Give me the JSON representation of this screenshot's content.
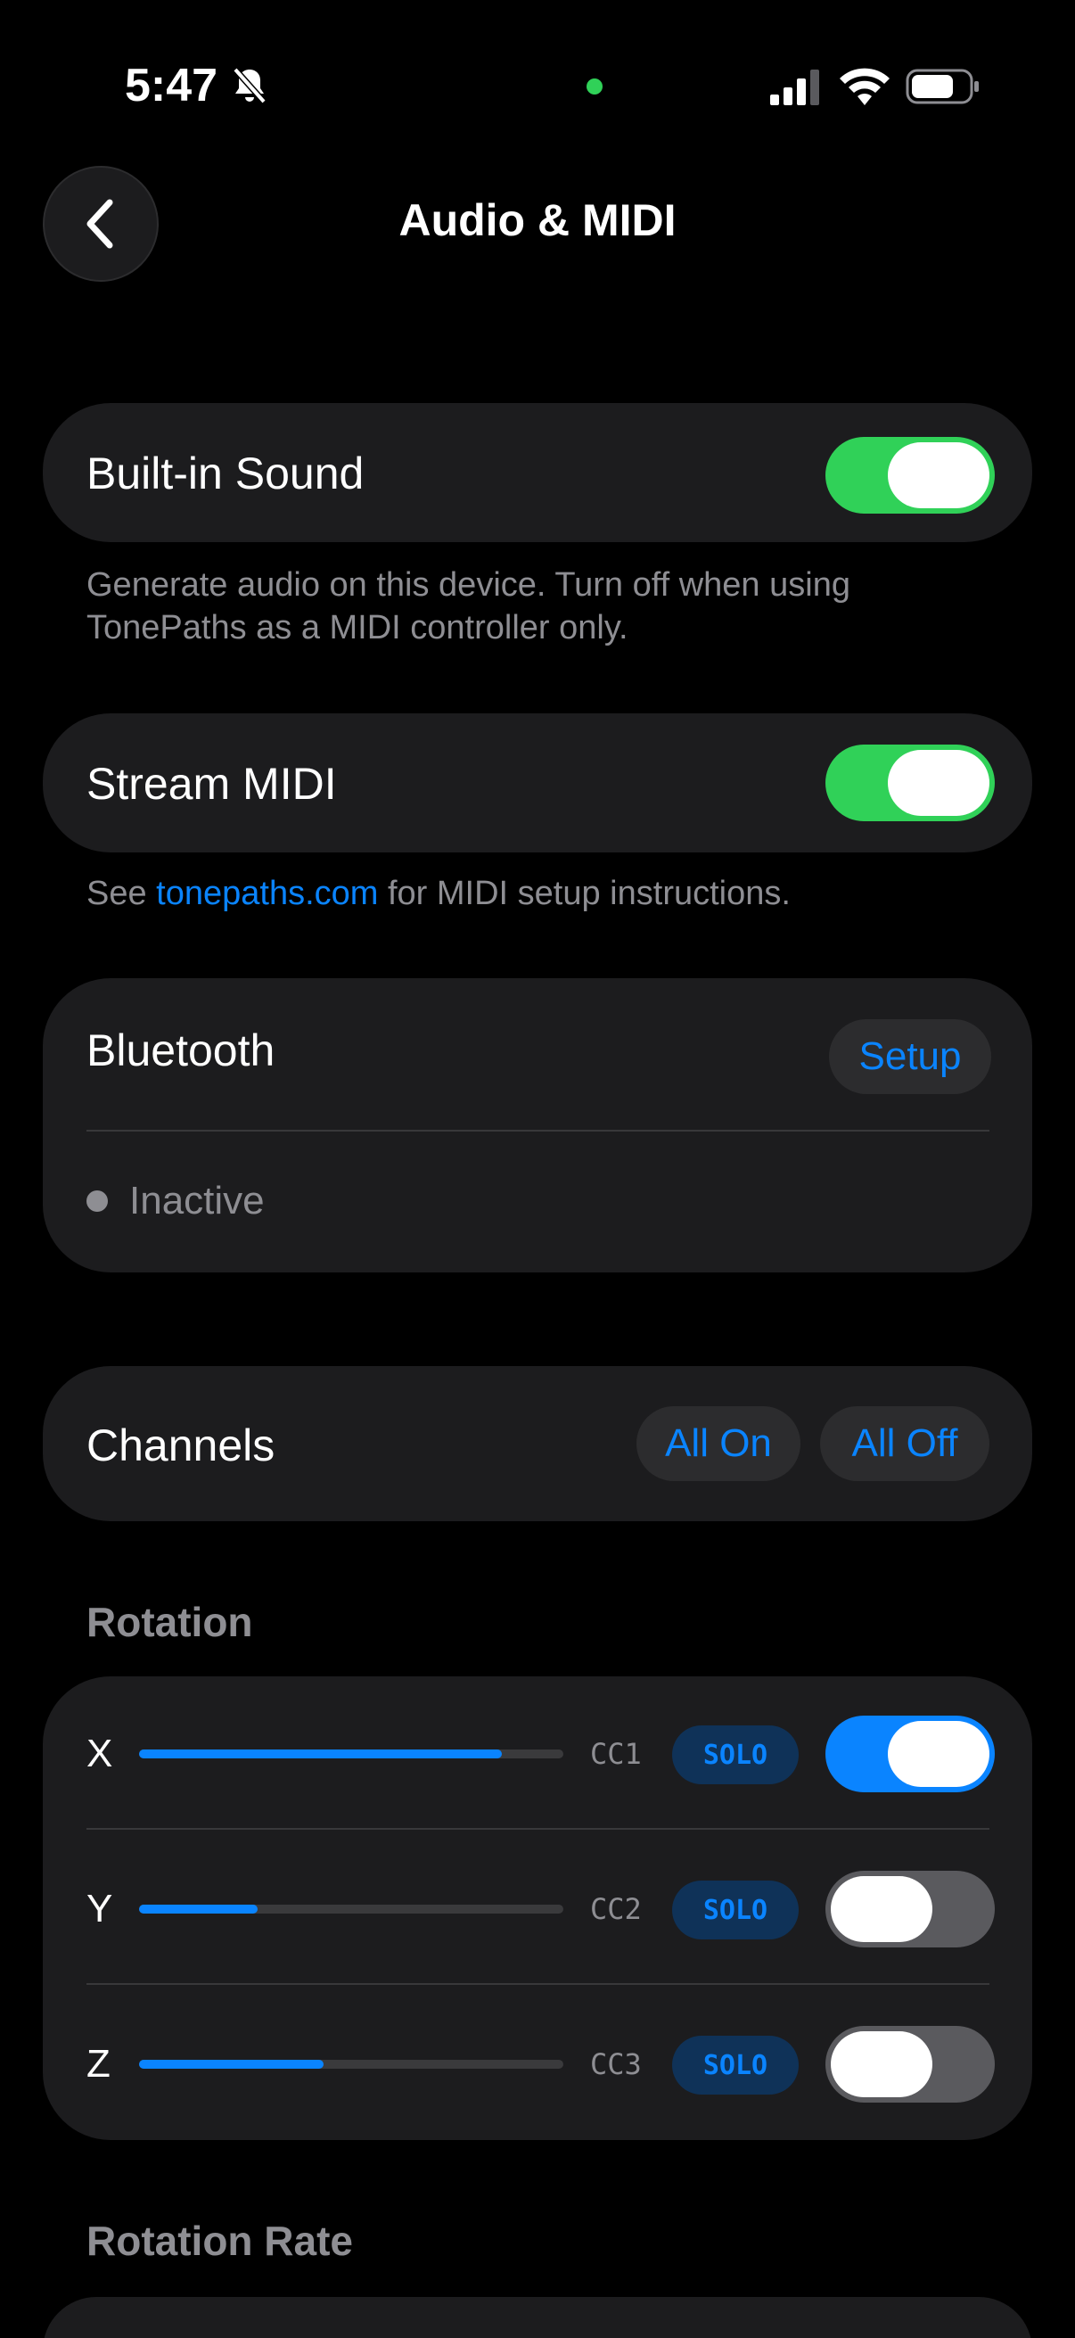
{
  "status_bar": {
    "time": "5:47"
  },
  "nav": {
    "title": "Audio & MIDI"
  },
  "built_in_sound": {
    "label": "Built-in Sound",
    "enabled": true,
    "footnote_line1": "Generate audio on this device. Turn off when using",
    "footnote_line2": "TonePaths as a MIDI controller only."
  },
  "stream_midi": {
    "label": "Stream MIDI",
    "enabled": true,
    "footnote_prefix": "See ",
    "footnote_link": "tonepaths.com",
    "footnote_suffix": " for MIDI setup instructions."
  },
  "bluetooth": {
    "label": "Bluetooth",
    "setup_label": "Setup",
    "status": "Inactive"
  },
  "channels": {
    "label": "Channels",
    "all_on_label": "All On",
    "all_off_label": "All Off"
  },
  "rotation": {
    "header": "Rotation",
    "rows": [
      {
        "axis": "X",
        "level": 0.855,
        "cc": "CC1",
        "solo_label": "SOLO",
        "enabled": true
      },
      {
        "axis": "Y",
        "level": 0.28,
        "cc": "CC2",
        "solo_label": "SOLO",
        "enabled": false
      },
      {
        "axis": "Z",
        "level": 0.435,
        "cc": "CC3",
        "solo_label": "SOLO",
        "enabled": false
      }
    ]
  },
  "rotation_rate": {
    "header": "Rotation Rate"
  },
  "colors": {
    "accent_blue": "#0a84ff",
    "toggle_green": "#30d158",
    "card_bg": "#1c1c1e",
    "secondary_text": "#8e8e93"
  }
}
